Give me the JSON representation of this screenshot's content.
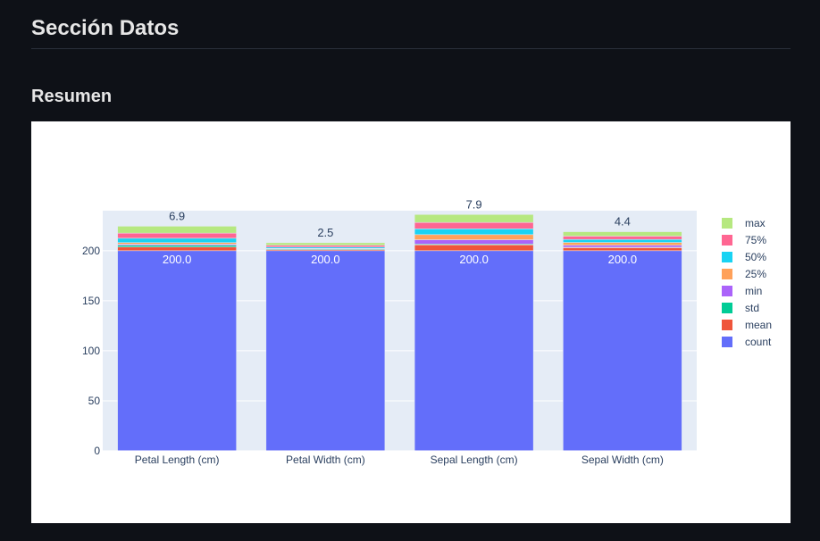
{
  "page": {
    "section_title": "Sección Datos",
    "subsection_title": "Resumen"
  },
  "chart_data": {
    "type": "bar",
    "barmode": "stack",
    "categories": [
      "Petal Length (cm)",
      "Petal Width (cm)",
      "Sepal Length (cm)",
      "Sepal Width (cm)"
    ],
    "series": [
      {
        "name": "count",
        "color": "#636efa",
        "values": [
          200.0,
          200.0,
          200.0,
          200.0
        ]
      },
      {
        "name": "mean",
        "color": "#ef553b",
        "values": [
          3.76,
          1.2,
          5.84,
          3.05
        ]
      },
      {
        "name": "std",
        "color": "#00cc96",
        "values": [
          1.76,
          0.76,
          0.83,
          0.43
        ]
      },
      {
        "name": "min",
        "color": "#ab63fa",
        "values": [
          1.0,
          0.1,
          4.3,
          2.0
        ]
      },
      {
        "name": "25%",
        "color": "#ffa15a",
        "values": [
          1.6,
          0.3,
          5.1,
          2.8
        ]
      },
      {
        "name": "50%",
        "color": "#19d3f3",
        "values": [
          4.35,
          1.3,
          5.8,
          3.0
        ]
      },
      {
        "name": "75%",
        "color": "#ff6692",
        "values": [
          5.1,
          1.8,
          6.4,
          3.3
        ]
      },
      {
        "name": "max",
        "color": "#b6e880",
        "values": [
          6.9,
          2.5,
          7.9,
          4.4
        ]
      }
    ],
    "yticks": [
      0,
      50,
      100,
      150,
      200
    ],
    "ylim": [
      0,
      240
    ],
    "legend_position": "right",
    "grid": true,
    "value_labels": {
      "count": [
        "200.0",
        "200.0",
        "200.0",
        "200.0"
      ],
      "max": [
        "6.9",
        "2.5",
        "7.9",
        "4.4"
      ]
    }
  }
}
